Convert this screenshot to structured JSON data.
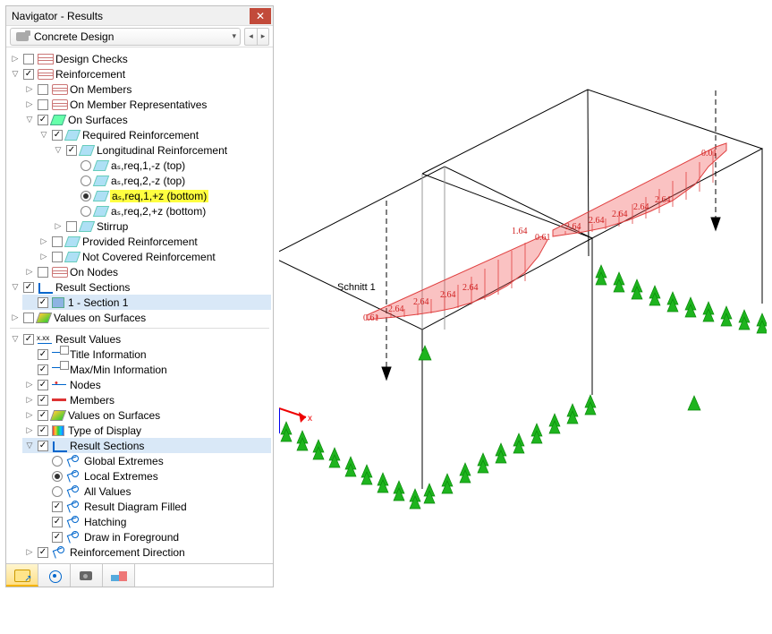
{
  "window": {
    "title": "Navigator - Results"
  },
  "selector": {
    "label": "Concrete Design"
  },
  "tree": {
    "design_checks": "Design Checks",
    "reinforcement": "Reinforcement",
    "on_members": "On Members",
    "on_member_reps": "On Member Representatives",
    "on_surfaces": "On Surfaces",
    "required_reinf": "Required Reinforcement",
    "longitudinal_reinf": "Longitudinal Reinforcement",
    "as1top": "aₛ,req,1,-z (top)",
    "as2top": "aₛ,req,2,-z (top)",
    "as1bot": "aₛ,req,1,+z (bottom)",
    "as2bot": "aₛ,req,2,+z (bottom)",
    "stirrup": "Stirrup",
    "provided_reinf": "Provided Reinforcement",
    "not_covered_reinf": "Not Covered Reinforcement",
    "on_nodes": "On Nodes",
    "result_sections": "Result Sections",
    "section_1": "1 - Section 1",
    "values_on_surfaces": "Values on Surfaces",
    "result_values": "Result Values",
    "title_information": "Title Information",
    "maxmin_information": "Max/Min Information",
    "nodes": "Nodes",
    "members": "Members",
    "values_on_surfaces2": "Values on Surfaces",
    "type_of_display": "Type of Display",
    "result_sections2": "Result Sections",
    "global_extremes": "Global Extremes",
    "local_extremes": "Local Extremes",
    "all_values": "All Values",
    "result_diagram_filled": "Result Diagram Filled",
    "hatching": "Hatching",
    "draw_in_foreground": "Draw in Foreground",
    "reinforcement_direction": "Reinforcement Direction"
  },
  "viewport": {
    "section_label": "Schnitt 1",
    "axis_x": "x",
    "annotations": [
      "0.61",
      "2.64",
      "2.64",
      "2.64",
      "2.64",
      "1.64",
      "0.61",
      "2.64",
      "2.64",
      "2.64",
      "2.64",
      "2.64",
      "0.01"
    ]
  }
}
